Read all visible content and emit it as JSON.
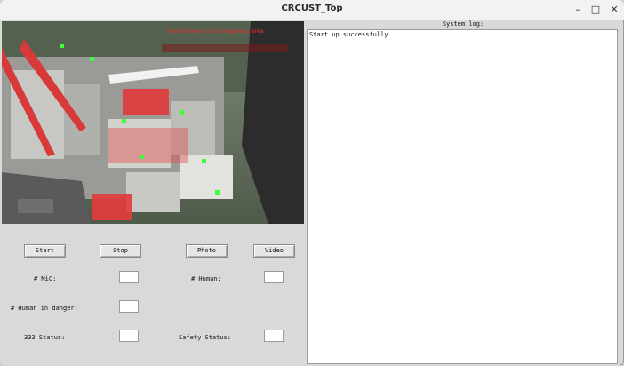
{
  "window": {
    "title": "CRCUST_Top"
  },
  "window_controls": {
    "minimize": "–",
    "maximize": "□",
    "close": "✕"
  },
  "camera": {
    "overlay_text": "Some human is in dangerous area"
  },
  "buttons": {
    "start": "Start",
    "stop": "Stop",
    "photo": "Photo",
    "video": "Video"
  },
  "status_fields": {
    "mic_label": "# MiC:",
    "human_label": "# Human:",
    "human_danger_label": "# Human in danger:",
    "status_333_label": "333 Status:",
    "safety_status_label": "Safety Status:",
    "mic_value": "",
    "human_value": "",
    "human_danger_value": "",
    "status_333_value": "",
    "safety_status_value": ""
  },
  "system_log": {
    "title": "System log:",
    "lines": "Start up successfully"
  }
}
